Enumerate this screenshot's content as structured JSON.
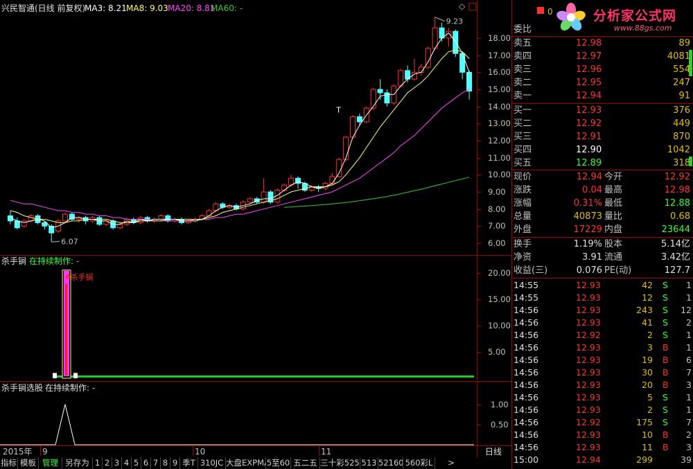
{
  "main_header": {
    "title": "兴民智通(日线 前复权)",
    "ma3": "MA3: 8.21",
    "ma8": "MA8: 9.03",
    "ma20": "MA20: 8.81",
    "ma60": "MA60: -"
  },
  "colors": {
    "up": "#ff3030",
    "down": "#54ffff",
    "ma3": "#ffffff",
    "ma8": "#ffff66",
    "ma20": "#ff44ff",
    "ma60": "#33cc33",
    "border": "#a00000"
  },
  "main_axis": [
    "18.00",
    "17.00",
    "16.00",
    "15.00",
    "14.00",
    "13.00",
    "12.00",
    "11.00",
    "10.00",
    "9.00",
    "8.00",
    "7.00",
    "6.00"
  ],
  "price_marks": {
    "high": "9.23",
    "low": "6.07",
    "t_marker": "T"
  },
  "ind1": {
    "name": "杀手锏",
    "status": "在持续制作: -",
    "signal": "*杀手锏",
    "axis": [
      "20.00",
      "15.00",
      "10.00",
      "5.00"
    ]
  },
  "ind2": {
    "name": "杀手锏选股",
    "status": "在持续制作: -",
    "axis": [
      "1.00",
      "0.50"
    ]
  },
  "date_axis": {
    "year": "2015年",
    "m9": "9",
    "m10": "10",
    "m11": "11",
    "period": "日线"
  },
  "bottom_tabs": [
    "指标",
    "模板",
    "管理",
    "另存为",
    "1",
    "2",
    "3",
    "4",
    "5",
    "6",
    "7",
    "8",
    "9",
    "季T",
    "310JC",
    "大盘EXPMA",
    "5至60",
    "五二五",
    "三十彩525",
    "513",
    "52160",
    "560彩L"
  ],
  "logo": {
    "name": "分析家公式网",
    "url": "www.88gs.com"
  },
  "orderbook": {
    "header": "委比",
    "header_value": "0",
    "sells": [
      {
        "label": "卖五",
        "price": "12.98",
        "vol": "89"
      },
      {
        "label": "卖四",
        "price": "12.97",
        "vol": "4081"
      },
      {
        "label": "卖三",
        "price": "12.96",
        "vol": "554"
      },
      {
        "label": "卖二",
        "price": "12.95",
        "vol": "247"
      },
      {
        "label": "卖一",
        "price": "12.94",
        "vol": "91"
      }
    ],
    "buys": [
      {
        "label": "买一",
        "price": "12.93",
        "vol": "376"
      },
      {
        "label": "买二",
        "price": "12.92",
        "vol": "449"
      },
      {
        "label": "买三",
        "price": "12.91",
        "vol": "870"
      },
      {
        "label": "买四",
        "price": "12.90",
        "vol": "1042"
      },
      {
        "label": "买五",
        "price": "12.89",
        "vol": "318"
      }
    ]
  },
  "stats": [
    {
      "l1": "现价",
      "v1": "12.94",
      "c1": "#ff3030",
      "l2": "今开",
      "v2": "12.92",
      "c2": "#ff3030"
    },
    {
      "l1": "涨跌",
      "v1": "0.04",
      "c1": "#ff3030",
      "l2": "最高",
      "v2": "12.98",
      "c2": "#ff3030"
    },
    {
      "l1": "涨幅",
      "v1": "0.31%",
      "c1": "#ff3030",
      "l2": "最低",
      "v2": "12.88",
      "c2": "#33ff33"
    },
    {
      "l1": "总量",
      "v1": "40873",
      "c1": "#e0c000",
      "l2": "量比",
      "v2": "0.68",
      "c2": "#e0c000"
    },
    {
      "l1": "外盘",
      "v1": "17229",
      "c1": "#ff3030",
      "l2": "内盘",
      "v2": "23644",
      "c2": "#33ff33"
    }
  ],
  "stats2": [
    {
      "l1": "换手",
      "v1": "1.19%",
      "l2": "股本",
      "v2": "5.14亿"
    },
    {
      "l1": "净资",
      "v1": "3.91",
      "l2": "流通",
      "v2": "3.42亿"
    },
    {
      "l1": "收益(三)",
      "v1": "0.076",
      "l2": "PE(动)",
      "v2": "127.7"
    }
  ],
  "ticks": [
    {
      "t": "14:55",
      "p": "12.93",
      "v": "42",
      "s": "S",
      "n": "1"
    },
    {
      "t": "14:55",
      "p": "12.93",
      "v": "12",
      "s": "S",
      "n": "1"
    },
    {
      "t": "14:56",
      "p": "12.93",
      "v": "243",
      "s": "S",
      "n": "12"
    },
    {
      "t": "14:56",
      "p": "12.93",
      "v": "41",
      "s": "S",
      "n": "2"
    },
    {
      "t": "14:56",
      "p": "12.92",
      "v": "2",
      "s": "S",
      "n": "1"
    },
    {
      "t": "14:56",
      "p": "12.93",
      "v": "3",
      "s": "B",
      "n": "1"
    },
    {
      "t": "14:56",
      "p": "12.93",
      "v": "19",
      "s": "B",
      "n": "6"
    },
    {
      "t": "14:56",
      "p": "12.93",
      "v": "30",
      "s": "B",
      "n": "7"
    },
    {
      "t": "14:56",
      "p": "12.93",
      "v": "20",
      "s": "B",
      "n": "3"
    },
    {
      "t": "14:56",
      "p": "12.93",
      "v": "5",
      "s": "S",
      "n": "1"
    },
    {
      "t": "14:56",
      "p": "12.93",
      "v": "2",
      "s": "S",
      "n": "1"
    },
    {
      "t": "14:56",
      "p": "12.92",
      "v": "175",
      "s": "S",
      "n": "7"
    },
    {
      "t": "14:56",
      "p": "12.93",
      "v": "10",
      "s": "B",
      "n": "2"
    },
    {
      "t": "14:56",
      "p": "12.93",
      "v": "11",
      "s": "B",
      "n": "3"
    },
    {
      "t": "15:00",
      "p": "12.94",
      "v": "299",
      "s": "",
      "n": "39"
    }
  ],
  "chart_data": [
    {
      "type": "candlestick",
      "title": "兴民智通(日线 前复权)",
      "ylim": [
        6,
        19
      ],
      "candles": [
        {
          "o": 7.6,
          "c": 7.3,
          "h": 7.9,
          "l": 7.1
        },
        {
          "o": 7.3,
          "c": 6.9,
          "h": 7.5,
          "l": 6.8
        },
        {
          "o": 7.0,
          "c": 7.3,
          "h": 7.4,
          "l": 6.9
        },
        {
          "o": 7.3,
          "c": 7.6,
          "h": 7.7,
          "l": 7.2
        },
        {
          "o": 7.6,
          "c": 7.2,
          "h": 7.7,
          "l": 7.1
        },
        {
          "o": 7.2,
          "c": 7.0,
          "h": 7.3,
          "l": 6.8
        },
        {
          "o": 7.0,
          "c": 6.6,
          "h": 7.1,
          "l": 6.07
        },
        {
          "o": 6.7,
          "c": 7.3,
          "h": 7.4,
          "l": 6.6
        },
        {
          "o": 7.3,
          "c": 7.7,
          "h": 7.8,
          "l": 7.2
        },
        {
          "o": 7.7,
          "c": 7.4,
          "h": 7.8,
          "l": 7.3
        },
        {
          "o": 7.4,
          "c": 7.5,
          "h": 7.6,
          "l": 7.2
        },
        {
          "o": 7.5,
          "c": 7.3,
          "h": 7.6,
          "l": 7.1
        },
        {
          "o": 7.3,
          "c": 7.5,
          "h": 7.6,
          "l": 7.2
        },
        {
          "o": 7.5,
          "c": 7.1,
          "h": 7.6,
          "l": 7.0
        },
        {
          "o": 7.1,
          "c": 7.3,
          "h": 7.4,
          "l": 7.0
        },
        {
          "o": 7.3,
          "c": 6.9,
          "h": 7.4,
          "l": 6.8
        },
        {
          "o": 6.9,
          "c": 7.1,
          "h": 7.2,
          "l": 6.8
        },
        {
          "o": 7.1,
          "c": 7.4,
          "h": 7.5,
          "l": 7.0
        },
        {
          "o": 7.4,
          "c": 7.2,
          "h": 7.5,
          "l": 7.1
        },
        {
          "o": 7.2,
          "c": 7.5,
          "h": 7.6,
          "l": 7.1
        },
        {
          "o": 7.5,
          "c": 7.3,
          "h": 7.6,
          "l": 7.2
        },
        {
          "o": 7.3,
          "c": 7.4,
          "h": 7.5,
          "l": 7.2
        },
        {
          "o": 7.4,
          "c": 7.6,
          "h": 7.7,
          "l": 7.3
        },
        {
          "o": 7.6,
          "c": 7.3,
          "h": 7.7,
          "l": 7.2
        },
        {
          "o": 7.3,
          "c": 7.4,
          "h": 7.5,
          "l": 7.2
        },
        {
          "o": 7.4,
          "c": 7.2,
          "h": 7.5,
          "l": 7.1
        },
        {
          "o": 7.2,
          "c": 7.3,
          "h": 7.4,
          "l": 7.1
        },
        {
          "o": 7.3,
          "c": 7.4,
          "h": 7.5,
          "l": 7.2
        },
        {
          "o": 7.4,
          "c": 7.6,
          "h": 7.7,
          "l": 7.3
        },
        {
          "o": 7.6,
          "c": 7.9,
          "h": 8.0,
          "l": 7.5
        },
        {
          "o": 7.9,
          "c": 8.3,
          "h": 8.4,
          "l": 7.8
        },
        {
          "o": 8.3,
          "c": 8.1,
          "h": 8.4,
          "l": 8.0
        },
        {
          "o": 8.1,
          "c": 8.2,
          "h": 8.3,
          "l": 8.0
        },
        {
          "o": 8.2,
          "c": 8.0,
          "h": 8.3,
          "l": 7.9
        },
        {
          "o": 8.0,
          "c": 8.4,
          "h": 8.5,
          "l": 7.9
        },
        {
          "o": 8.4,
          "c": 8.6,
          "h": 8.7,
          "l": 8.3
        },
        {
          "o": 8.6,
          "c": 8.4,
          "h": 8.7,
          "l": 8.3
        },
        {
          "o": 8.4,
          "c": 9.0,
          "h": 9.8,
          "l": 8.3
        },
        {
          "o": 9.0,
          "c": 8.4,
          "h": 9.1,
          "l": 8.3
        },
        {
          "o": 8.4,
          "c": 9.1,
          "h": 9.2,
          "l": 8.3
        },
        {
          "o": 9.1,
          "c": 9.4,
          "h": 9.5,
          "l": 9.0
        },
        {
          "o": 9.4,
          "c": 9.8,
          "h": 10.0,
          "l": 9.3
        },
        {
          "o": 9.8,
          "c": 9.5,
          "h": 9.9,
          "l": 9.2
        },
        {
          "o": 9.5,
          "c": 9.1,
          "h": 9.6,
          "l": 9.0
        },
        {
          "o": 9.1,
          "c": 9.3,
          "h": 9.4,
          "l": 9.0
        },
        {
          "o": 9.3,
          "c": 9.2,
          "h": 9.4,
          "l": 9.0
        },
        {
          "o": 9.2,
          "c": 9.5,
          "h": 9.6,
          "l": 9.1
        },
        {
          "o": 9.5,
          "c": 9.9,
          "h": 10.1,
          "l": 9.4
        },
        {
          "o": 9.9,
          "c": 10.9,
          "h": 11.0,
          "l": 9.8
        },
        {
          "o": 10.9,
          "c": 12.2,
          "h": 12.3,
          "l": 10.8
        },
        {
          "o": 12.2,
          "c": 13.4,
          "h": 13.5,
          "l": 12.1
        },
        {
          "o": 13.4,
          "c": 13.1,
          "h": 13.6,
          "l": 12.9
        },
        {
          "o": 13.1,
          "c": 13.9,
          "h": 14.0,
          "l": 13.0
        },
        {
          "o": 13.9,
          "c": 15.0,
          "h": 15.1,
          "l": 13.8
        },
        {
          "o": 15.0,
          "c": 14.8,
          "h": 15.6,
          "l": 14.4
        },
        {
          "o": 14.8,
          "c": 14.2,
          "h": 15.0,
          "l": 14.0
        },
        {
          "o": 14.2,
          "c": 15.2,
          "h": 15.3,
          "l": 14.1
        },
        {
          "o": 15.2,
          "c": 16.1,
          "h": 16.2,
          "l": 15.1
        },
        {
          "o": 16.1,
          "c": 15.6,
          "h": 16.4,
          "l": 15.4
        },
        {
          "o": 15.6,
          "c": 16.0,
          "h": 16.8,
          "l": 15.5
        },
        {
          "o": 16.0,
          "c": 16.3,
          "h": 16.5,
          "l": 15.8
        },
        {
          "o": 16.3,
          "c": 17.4,
          "h": 17.5,
          "l": 16.2
        },
        {
          "o": 17.4,
          "c": 18.6,
          "h": 19.23,
          "l": 17.3
        },
        {
          "o": 18.6,
          "c": 18.0,
          "h": 18.9,
          "l": 17.8
        },
        {
          "o": 18.0,
          "c": 18.4,
          "h": 18.6,
          "l": 17.5
        },
        {
          "o": 18.4,
          "c": 17.1,
          "h": 18.5,
          "l": 16.9
        },
        {
          "o": 17.1,
          "c": 16.0,
          "h": 17.2,
          "l": 15.6
        },
        {
          "o": 16.0,
          "c": 14.9,
          "h": 16.1,
          "l": 14.4
        }
      ],
      "ma3": [
        7.5,
        7.3,
        7.2,
        7.3,
        7.4,
        7.3,
        6.9,
        7.0,
        7.2,
        7.5,
        7.5,
        7.4,
        7.4,
        7.3,
        7.3,
        7.1,
        7.1,
        7.3,
        7.2,
        7.4,
        7.3,
        7.4,
        7.4,
        7.4,
        7.4,
        7.3,
        7.3,
        7.3,
        7.4,
        7.6,
        7.9,
        8.1,
        8.2,
        8.1,
        8.2,
        8.3,
        8.5,
        8.6,
        8.6,
        8.8,
        9.1,
        9.4,
        9.6,
        9.5,
        9.3,
        9.2,
        9.3,
        9.5,
        10.1,
        11.0,
        12.2,
        12.9,
        13.5,
        14.0,
        14.6,
        14.7,
        14.7,
        15.2,
        15.6,
        15.9,
        16.0,
        16.6,
        17.4,
        18.0,
        18.3,
        17.8,
        17.1,
        16.0
      ],
      "ma8": [
        7.9,
        7.8,
        7.6,
        7.5,
        7.4,
        7.4,
        7.3,
        7.2,
        7.2,
        7.3,
        7.3,
        7.4,
        7.4,
        7.4,
        7.4,
        7.3,
        7.2,
        7.2,
        7.2,
        7.3,
        7.3,
        7.3,
        7.3,
        7.4,
        7.4,
        7.4,
        7.4,
        7.4,
        7.4,
        7.5,
        7.6,
        7.8,
        7.9,
        8.0,
        8.1,
        8.2,
        8.3,
        8.4,
        8.5,
        8.6,
        8.8,
        9.0,
        9.1,
        9.2,
        9.3,
        9.3,
        9.3,
        9.4,
        9.6,
        10.0,
        10.5,
        11.0,
        11.6,
        12.2,
        12.8,
        13.3,
        13.8,
        14.3,
        14.8,
        15.1,
        15.4,
        15.8,
        16.3,
        16.8,
        17.2,
        17.3,
        17.2,
        16.8
      ],
      "ma20": [
        8.5,
        8.4,
        8.3,
        8.3,
        8.2,
        8.1,
        8.0,
        7.9,
        7.9,
        7.8,
        7.8,
        7.7,
        7.7,
        7.6,
        7.6,
        7.5,
        7.5,
        7.4,
        7.4,
        7.4,
        7.4,
        7.3,
        7.3,
        7.3,
        7.3,
        7.3,
        7.3,
        7.4,
        7.4,
        7.4,
        7.5,
        7.5,
        7.6,
        7.7,
        7.7,
        7.8,
        7.9,
        8.0,
        8.1,
        8.2,
        8.3,
        8.4,
        8.5,
        8.6,
        8.7,
        8.8,
        8.9,
        9.0,
        9.2,
        9.4,
        9.6,
        9.8,
        10.1,
        10.4,
        10.7,
        11.0,
        11.3,
        11.7,
        12.0,
        12.3,
        12.7,
        13.1,
        13.5,
        13.9,
        14.2,
        14.5,
        14.8,
        15.0
      ],
      "ma60_start": 40,
      "ma60": [
        8.1,
        8.12,
        8.15,
        8.17,
        8.2,
        8.23,
        8.26,
        8.3,
        8.34,
        8.38,
        8.43,
        8.48,
        8.54,
        8.6,
        8.66,
        8.73,
        8.81,
        8.89,
        8.98,
        9.07,
        9.16,
        9.26,
        9.36,
        9.46,
        9.56,
        9.66,
        9.76,
        9.86
      ]
    },
    {
      "type": "bar",
      "title": "杀手锏",
      "ylim": [
        0,
        21
      ],
      "signal_index": 8,
      "signal_value": 20.5,
      "baseline": 0.4
    },
    {
      "type": "line",
      "title": "杀手锏选股",
      "ylim": [
        0,
        1.2
      ],
      "peak_index": 8,
      "peak_value": 1
    }
  ]
}
